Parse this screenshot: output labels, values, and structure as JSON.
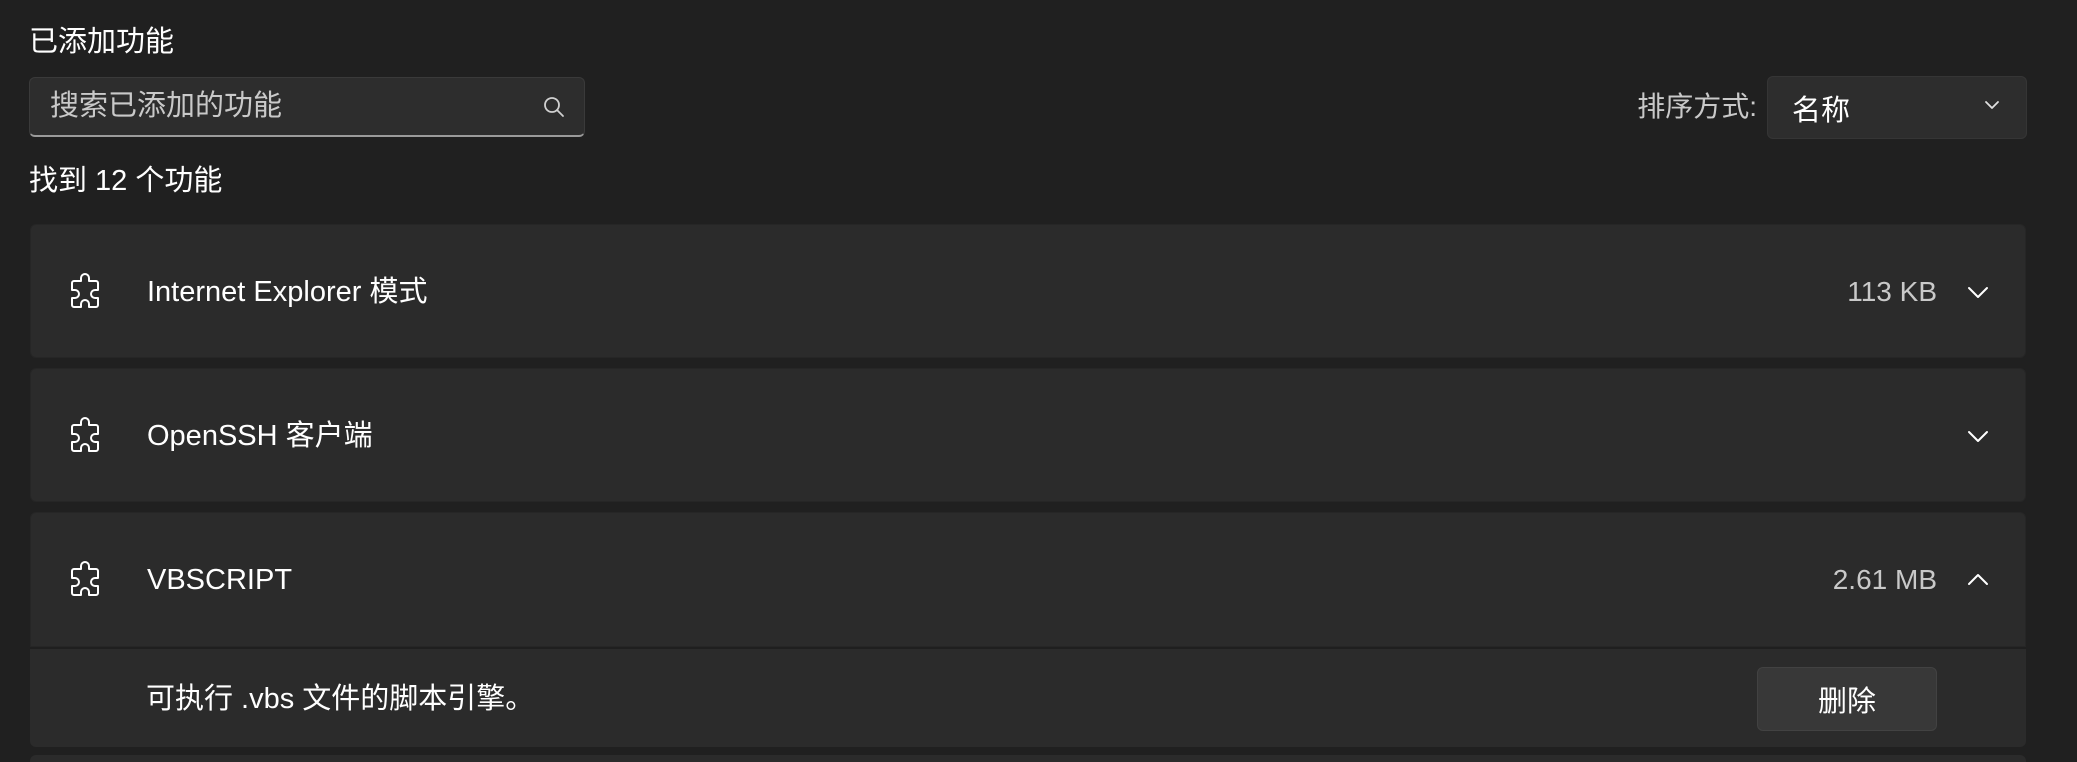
{
  "section_title": "已添加功能",
  "search": {
    "placeholder": "搜索已添加的功能",
    "value": "",
    "icon": "search-icon"
  },
  "sort": {
    "label": "排序方式:",
    "selected": "名称",
    "icon": "chevron-down-icon"
  },
  "result_count": "找到 12 个功能",
  "features": [
    {
      "name": "Internet Explorer 模式",
      "size": "113 KB",
      "expanded": false,
      "icon": "puzzle-icon"
    },
    {
      "name": "OpenSSH 客户端",
      "size": "",
      "expanded": false,
      "icon": "puzzle-icon"
    },
    {
      "name": "VBSCRIPT",
      "size": "2.61 MB",
      "expanded": true,
      "icon": "puzzle-icon",
      "description": "可执行 .vbs 文件的脚本引擎。",
      "action_label": "删除"
    }
  ]
}
